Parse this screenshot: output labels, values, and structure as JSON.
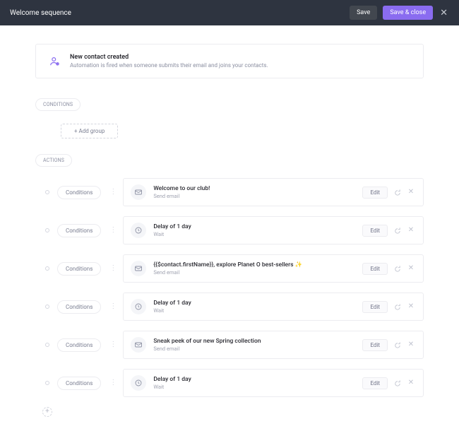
{
  "header": {
    "title": "Welcome sequence",
    "save": "Save",
    "save_close": "Save & close"
  },
  "trigger": {
    "title": "New contact created",
    "desc": "Automation is fired when someone submits their email and joins your contacts."
  },
  "sections": {
    "conditions": "CONDITIONS",
    "actions": "ACTIONS",
    "add_group": "+ Add group"
  },
  "labels": {
    "conditions_btn": "Conditions",
    "edit": "Edit"
  },
  "actions": [
    {
      "icon": "mail",
      "title": "Welcome to our club!",
      "sub": "Send email"
    },
    {
      "icon": "clock",
      "title": "Delay of 1 day",
      "sub": "Wait"
    },
    {
      "icon": "mail",
      "title": "{{$contact.firstName}}, explore Planet O best-sellers ✨",
      "sub": "Send email"
    },
    {
      "icon": "clock",
      "title": "Delay of 1 day",
      "sub": "Wait"
    },
    {
      "icon": "mail",
      "title": "Sneak peek of our new Spring collection",
      "sub": "Send email"
    },
    {
      "icon": "clock",
      "title": "Delay of 1 day",
      "sub": "Wait"
    }
  ]
}
